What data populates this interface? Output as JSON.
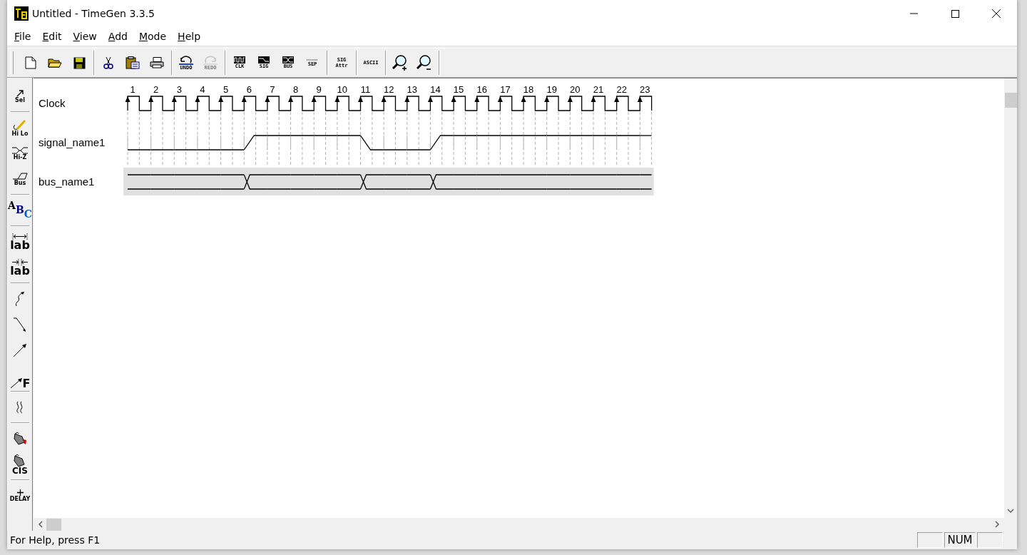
{
  "window": {
    "title": "Untitled - TimeGen 3.3.5"
  },
  "menu": [
    {
      "label": "File"
    },
    {
      "label": "Edit"
    },
    {
      "label": "View"
    },
    {
      "label": "Add"
    },
    {
      "label": "Mode"
    },
    {
      "label": "Help"
    }
  ],
  "toolbar": [
    [
      {
        "kind": "new",
        "disabled": false
      },
      {
        "kind": "open",
        "disabled": false
      },
      {
        "kind": "save",
        "disabled": false
      }
    ],
    [
      {
        "kind": "cut",
        "disabled": false
      },
      {
        "kind": "paste",
        "disabled": false
      },
      {
        "kind": "print",
        "disabled": false
      }
    ],
    [
      {
        "kind": "undo",
        "label": "UNDO",
        "disabled": false
      },
      {
        "kind": "redo",
        "label": "REDO",
        "disabled": true
      }
    ],
    [
      {
        "kind": "clk",
        "label": "CLK",
        "disabled": false
      },
      {
        "kind": "sig",
        "label": "SIG",
        "disabled": false
      },
      {
        "kind": "bus",
        "label": "BUS",
        "disabled": false
      },
      {
        "kind": "sep",
        "label": "SEP",
        "disabled": false
      }
    ],
    [
      {
        "kind": "attr",
        "label": "SIG",
        "label2": "Attr",
        "disabled": false
      }
    ],
    [
      {
        "kind": "ascii",
        "label": "ASCII",
        "disabled": false
      }
    ],
    [
      {
        "kind": "zoom-in",
        "disabled": false
      },
      {
        "kind": "zoom-out",
        "disabled": false
      }
    ]
  ],
  "palette": [
    {
      "kind": "select",
      "label": "Sel"
    },
    {
      "kind": "separator"
    },
    {
      "kind": "hilo",
      "label": "Hi Lo"
    },
    {
      "kind": "hiz",
      "label": "Hi-Z"
    },
    {
      "kind": "bus",
      "label": "Bus"
    },
    {
      "kind": "separator"
    },
    {
      "kind": "text",
      "letters": [
        "A",
        "B",
        "C"
      ]
    },
    {
      "kind": "separator"
    },
    {
      "kind": "delay-label",
      "label": "lab"
    },
    {
      "kind": "setup-label",
      "label": "lab"
    },
    {
      "kind": "separator"
    },
    {
      "kind": "curve-arrow"
    },
    {
      "kind": "bent-arrow"
    },
    {
      "kind": "arrow"
    },
    {
      "kind": "arrow-f",
      "label": "F"
    },
    {
      "kind": "separator"
    },
    {
      "kind": "break"
    },
    {
      "kind": "separator"
    },
    {
      "kind": "bucket"
    },
    {
      "kind": "bucket-cis",
      "label": "CIS"
    },
    {
      "kind": "separator"
    },
    {
      "kind": "delay",
      "label": "DELAY"
    }
  ],
  "cycles": [
    "1",
    "2",
    "3",
    "4",
    "5",
    "6",
    "7",
    "8",
    "9",
    "10",
    "11",
    "12",
    "13",
    "14",
    "15",
    "16",
    "17",
    "18",
    "19",
    "20",
    "21",
    "22",
    "23"
  ],
  "signals": [
    {
      "kind": "clock",
      "name": "Clock"
    },
    {
      "kind": "signal",
      "name": "signal_name1",
      "high": [
        false,
        false,
        false,
        false,
        false,
        true,
        true,
        true,
        true,
        true,
        false,
        false,
        false,
        true,
        true,
        true,
        true,
        true,
        true,
        true,
        true,
        true,
        true
      ]
    },
    {
      "kind": "bus",
      "name": "bus_name1",
      "transition": [
        false,
        false,
        false,
        false,
        false,
        true,
        false,
        false,
        false,
        false,
        true,
        false,
        false,
        true,
        false,
        false,
        false,
        false,
        false,
        false,
        false,
        false,
        false
      ]
    }
  ],
  "status_bar": {
    "text": "For Help, press F1",
    "panes": [
      "NUM"
    ]
  }
}
